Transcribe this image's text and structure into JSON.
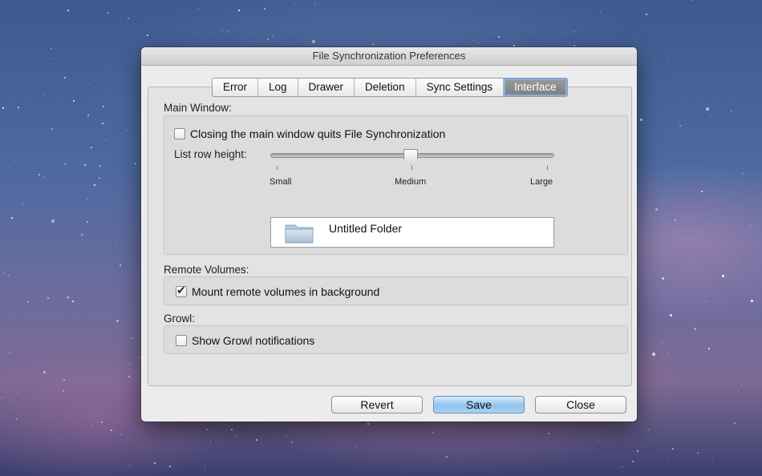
{
  "window": {
    "title": "File Synchronization Preferences"
  },
  "tabs": [
    {
      "label": "Error",
      "selected": false
    },
    {
      "label": "Log",
      "selected": false
    },
    {
      "label": "Drawer",
      "selected": false
    },
    {
      "label": "Deletion",
      "selected": false
    },
    {
      "label": "Sync Settings",
      "selected": false
    },
    {
      "label": "Interface",
      "selected": true
    }
  ],
  "main_window": {
    "label": "Main Window:",
    "closing_quits_checkbox": {
      "label": "Closing the main window quits File Synchronization",
      "checked": false
    },
    "row_height": {
      "label": "List row height:",
      "ticks": [
        "Small",
        "Medium",
        "Large"
      ],
      "value": "Medium"
    },
    "preview": {
      "icon": "folder-icon",
      "text": "Untitled Folder"
    }
  },
  "remote_volumes": {
    "label": "Remote Volumes:",
    "mount_checkbox": {
      "label": "Mount remote volumes in background",
      "checked": true
    }
  },
  "growl": {
    "label": "Growl:",
    "notify_checkbox": {
      "label": "Show Growl notifications",
      "checked": false
    }
  },
  "buttons": {
    "revert": "Revert",
    "save": "Save",
    "close": "Close"
  },
  "colors": {
    "accent": "#8fc3ee",
    "selected_tab": "#8a8a8a"
  }
}
